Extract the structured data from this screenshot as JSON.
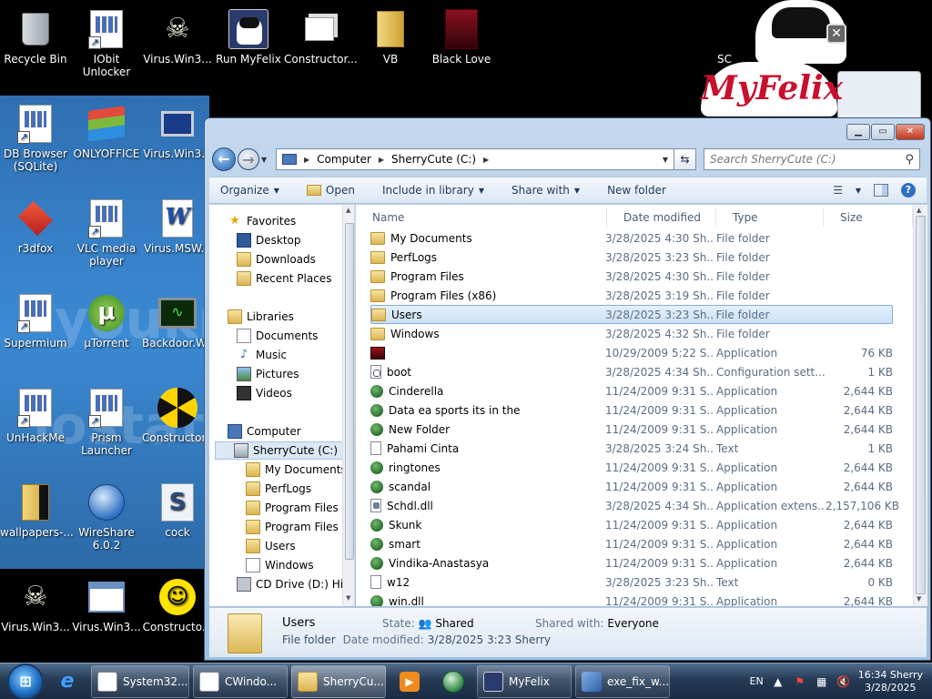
{
  "desktop": {
    "icons": [
      {
        "label": "Recycle Bin",
        "icon": "recycle-bin-icon"
      },
      {
        "label": "IObit Unlocker",
        "icon": "app-shortcut-icon"
      },
      {
        "label": "Virus.Win3...",
        "icon": "skull-icon"
      },
      {
        "label": "Run MyFelix",
        "icon": "cat-icon"
      },
      {
        "label": "Constructor...",
        "icon": "folder-stack-icon"
      },
      {
        "label": "VB",
        "icon": "folder-icon"
      },
      {
        "label": "Black Love",
        "icon": "red-cube-icon"
      },
      {
        "label": "DB Browser (SQLite)",
        "icon": "app-shortcut-icon"
      },
      {
        "label": "ONLYOFFICE",
        "icon": "layers-icon"
      },
      {
        "label": "Virus.Win3...",
        "icon": "computer-icon"
      },
      {
        "label": "r3dfox",
        "icon": "red-fox-icon"
      },
      {
        "label": "VLC media player",
        "icon": "app-shortcut-icon"
      },
      {
        "label": "Virus.MSW...",
        "icon": "word-doc-icon"
      },
      {
        "label": "Supermium",
        "icon": "app-shortcut-icon"
      },
      {
        "label": "µTorrent",
        "icon": "utorrent-icon"
      },
      {
        "label": "Backdoor.W...",
        "icon": "oscilloscope-icon"
      },
      {
        "label": "UnHackMe",
        "icon": "app-shortcut-icon"
      },
      {
        "label": "Prism Launcher",
        "icon": "app-shortcut-icon"
      },
      {
        "label": "Constructor...",
        "icon": "radiation-icon"
      },
      {
        "label": "wallpapers-...",
        "icon": "folder-icon"
      },
      {
        "label": "WireShare 6.0.2",
        "icon": "globe-icon"
      },
      {
        "label": "cock",
        "icon": "script-icon"
      },
      {
        "label": "Virus.Win3...",
        "icon": "skull-icon"
      },
      {
        "label": "Virus.Win3...",
        "icon": "window-app-icon"
      },
      {
        "label": "Constructo...",
        "icon": "smiley-icon"
      }
    ],
    "watermark": [
      "youkr",
      "lostato"
    ],
    "myfelix": {
      "brand": "MyFelix",
      "partial_label": "SC"
    }
  },
  "window": {
    "address": {
      "parts": [
        "Computer",
        "SherryCute (C:)"
      ]
    },
    "search": {
      "placeholder": "Search SherryCute (C:)"
    },
    "toolbar": {
      "organize": "Organize",
      "open": "Open",
      "include": "Include in library",
      "share": "Share with",
      "newfolder": "New folder"
    },
    "nav": {
      "favorites": "Favorites",
      "desktop": "Desktop",
      "downloads": "Downloads",
      "recent": "Recent Places",
      "libraries": "Libraries",
      "documents": "Documents",
      "music": "Music",
      "pictures": "Pictures",
      "videos": "Videos",
      "computer": "Computer",
      "drive_c": "SherryCute (C:)",
      "sub1": "My Documents",
      "sub2": "PerfLogs",
      "sub3": "Program Files",
      "sub4": "Program Files (",
      "sub5": "Users",
      "sub6": "Windows",
      "drive_d": "CD Drive (D:) Hir"
    },
    "columns": {
      "name": "Name",
      "date": "Date modified",
      "type": "Type",
      "size": "Size"
    },
    "files": [
      {
        "name": "My Documents",
        "date": "3/28/2025 4:30 Sh...",
        "type": "File folder",
        "size": "",
        "icon": "folder"
      },
      {
        "name": "PerfLogs",
        "date": "3/28/2025 3:23 Sh...",
        "type": "File folder",
        "size": "",
        "icon": "folder"
      },
      {
        "name": "Program Files",
        "date": "3/28/2025 4:30 Sh...",
        "type": "File folder",
        "size": "",
        "icon": "folder"
      },
      {
        "name": "Program Files (x86)",
        "date": "3/28/2025 3:19 Sh...",
        "type": "File folder",
        "size": "",
        "icon": "folder"
      },
      {
        "name": "Users",
        "date": "3/28/2025 3:23 Sh...",
        "type": "File folder",
        "size": "",
        "icon": "folder",
        "selected": true
      },
      {
        "name": "Windows",
        "date": "3/28/2025 4:32 Sh...",
        "type": "File folder",
        "size": "",
        "icon": "folder"
      },
      {
        "name": "",
        "date": "10/29/2009 5:22 S...",
        "type": "Application",
        "size": "76 KB",
        "icon": "red"
      },
      {
        "name": "boot",
        "date": "3/28/2025 4:34 Sh...",
        "type": "Configuration sett...",
        "size": "1 KB",
        "icon": "cfg"
      },
      {
        "name": "Cinderella",
        "date": "11/24/2009 9:31 S...",
        "type": "Application",
        "size": "2,644 KB",
        "icon": "app"
      },
      {
        "name": "Data ea sports its in the",
        "date": "11/24/2009 9:31 S...",
        "type": "Application",
        "size": "2,644 KB",
        "icon": "app"
      },
      {
        "name": "New Folder",
        "date": "11/24/2009 9:31 S...",
        "type": "Application",
        "size": "2,644 KB",
        "icon": "app"
      },
      {
        "name": "Pahami Cinta",
        "date": "3/28/2025 3:24 Sh...",
        "type": "Text",
        "size": "1 KB",
        "icon": "txt"
      },
      {
        "name": "ringtones",
        "date": "11/24/2009 9:31 S...",
        "type": "Application",
        "size": "2,644 KB",
        "icon": "app"
      },
      {
        "name": "scandal",
        "date": "11/24/2009 9:31 S...",
        "type": "Application",
        "size": "2,644 KB",
        "icon": "app"
      },
      {
        "name": "Schdl.dll",
        "date": "3/28/2025 4:34 Sh...",
        "type": "Application extens...",
        "size": "2,157,106 KB",
        "icon": "dll"
      },
      {
        "name": "Skunk",
        "date": "11/24/2009 9:31 S...",
        "type": "Application",
        "size": "2,644 KB",
        "icon": "app"
      },
      {
        "name": "smart",
        "date": "11/24/2009 9:31 S...",
        "type": "Application",
        "size": "2,644 KB",
        "icon": "app"
      },
      {
        "name": "Vindika-Anastasya",
        "date": "11/24/2009 9:31 S...",
        "type": "Application",
        "size": "2,644 KB",
        "icon": "app"
      },
      {
        "name": "w12",
        "date": "3/28/2025 3:23 Sh...",
        "type": "Text",
        "size": "0 KB",
        "icon": "txt"
      },
      {
        "name": "win.dll",
        "date": "11/24/2009 9:31 S...",
        "type": "Application",
        "size": "2,644 KB",
        "icon": "app"
      }
    ],
    "details": {
      "name": "Users",
      "type": "File folder",
      "state_label": "State:",
      "state_value": "Shared",
      "date_label": "Date modified:",
      "date_value": "3/28/2025 3:23 Sherry",
      "shared_label": "Shared with:",
      "shared_value": "Everyone"
    }
  },
  "taskbar": {
    "buttons": [
      {
        "label": "System32...",
        "icon": "document-icon"
      },
      {
        "label": "CWindo...",
        "icon": "app-shortcut-icon"
      },
      {
        "label": "SherryCu...",
        "icon": "explorer-icon",
        "active": true
      },
      {
        "label": "MyFelix",
        "icon": "cat-icon"
      },
      {
        "label": "exe_fix_w...",
        "icon": "registry-icon"
      }
    ],
    "lang": "EN",
    "time": "16:34 Sherry",
    "date": "3/28/2025"
  }
}
